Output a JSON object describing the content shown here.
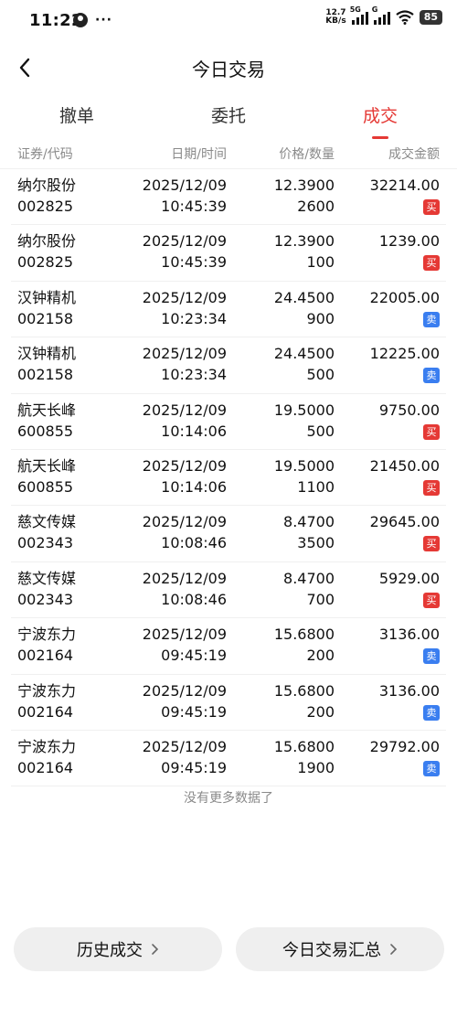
{
  "status_bar": {
    "time": "11:22",
    "net_speed_top": "12.7",
    "net_speed_bottom": "KB/s",
    "signal1_tag": "5G",
    "signal2_tag": "G",
    "battery": "85"
  },
  "header": {
    "title": "今日交易"
  },
  "tabs": [
    {
      "label": "撤单"
    },
    {
      "label": "委托"
    },
    {
      "label": "成交"
    }
  ],
  "columns": {
    "security": "证券/代码",
    "datetime": "日期/时间",
    "price_qty": "价格/数量",
    "amount": "成交金额"
  },
  "trades": [
    {
      "name": "纳尔股份",
      "code": "002825",
      "date": "2025/12/09",
      "time": "10:45:39",
      "price": "12.3900",
      "qty": "2600",
      "amount": "32214.00",
      "side": "买",
      "side_type": "buy"
    },
    {
      "name": "纳尔股份",
      "code": "002825",
      "date": "2025/12/09",
      "time": "10:45:39",
      "price": "12.3900",
      "qty": "100",
      "amount": "1239.00",
      "side": "买",
      "side_type": "buy"
    },
    {
      "name": "汉钟精机",
      "code": "002158",
      "date": "2025/12/09",
      "time": "10:23:34",
      "price": "24.4500",
      "qty": "900",
      "amount": "22005.00",
      "side": "卖",
      "side_type": "sell"
    },
    {
      "name": "汉钟精机",
      "code": "002158",
      "date": "2025/12/09",
      "time": "10:23:34",
      "price": "24.4500",
      "qty": "500",
      "amount": "12225.00",
      "side": "卖",
      "side_type": "sell"
    },
    {
      "name": "航天长峰",
      "code": "600855",
      "date": "2025/12/09",
      "time": "10:14:06",
      "price": "19.5000",
      "qty": "500",
      "amount": "9750.00",
      "side": "买",
      "side_type": "buy"
    },
    {
      "name": "航天长峰",
      "code": "600855",
      "date": "2025/12/09",
      "time": "10:14:06",
      "price": "19.5000",
      "qty": "1100",
      "amount": "21450.00",
      "side": "买",
      "side_type": "buy"
    },
    {
      "name": "慈文传媒",
      "code": "002343",
      "date": "2025/12/09",
      "time": "10:08:46",
      "price": "8.4700",
      "qty": "3500",
      "amount": "29645.00",
      "side": "买",
      "side_type": "buy"
    },
    {
      "name": "慈文传媒",
      "code": "002343",
      "date": "2025/12/09",
      "time": "10:08:46",
      "price": "8.4700",
      "qty": "700",
      "amount": "5929.00",
      "side": "买",
      "side_type": "buy"
    },
    {
      "name": "宁波东力",
      "code": "002164",
      "date": "2025/12/09",
      "time": "09:45:19",
      "price": "15.6800",
      "qty": "200",
      "amount": "3136.00",
      "side": "卖",
      "side_type": "sell"
    },
    {
      "name": "宁波东力",
      "code": "002164",
      "date": "2025/12/09",
      "time": "09:45:19",
      "price": "15.6800",
      "qty": "200",
      "amount": "3136.00",
      "side": "卖",
      "side_type": "sell"
    },
    {
      "name": "宁波东力",
      "code": "002164",
      "date": "2025/12/09",
      "time": "09:45:19",
      "price": "15.6800",
      "qty": "1900",
      "amount": "29792.00",
      "side": "卖",
      "side_type": "sell"
    }
  ],
  "no_more_text": "没有更多数据了",
  "buttons": {
    "history": "历史成交",
    "summary": "今日交易汇总"
  },
  "colors": {
    "accent": "#e53935",
    "buy": "#e53935",
    "sell": "#3a7ef0"
  },
  "icons": {
    "back": "chevron-left-icon",
    "button_arrow": "chevron-right-icon"
  }
}
